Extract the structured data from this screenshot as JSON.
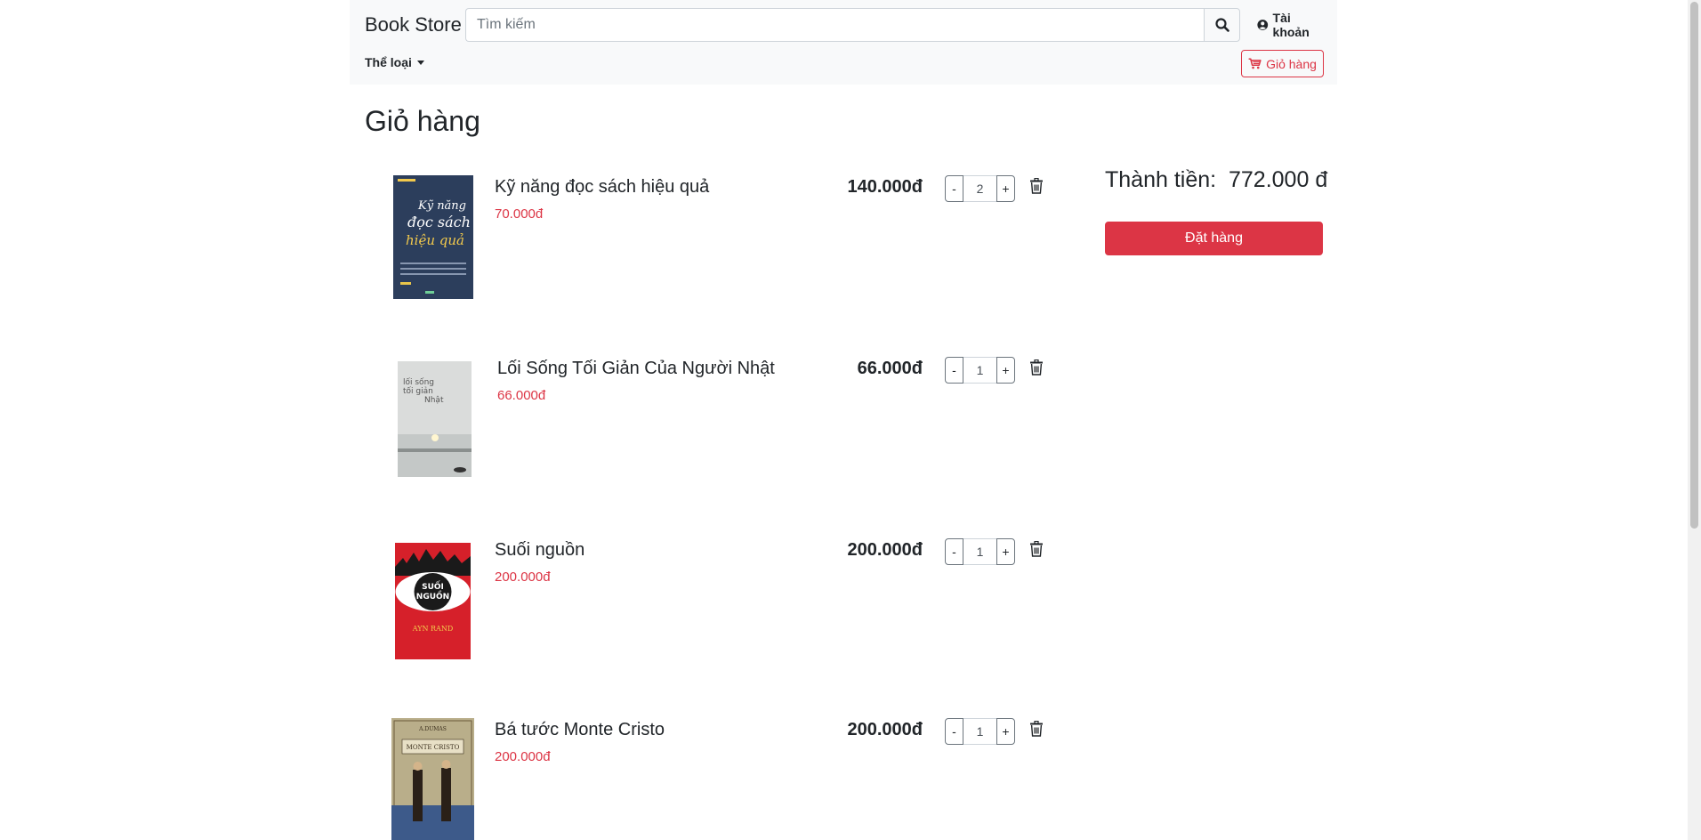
{
  "header": {
    "brand": "Book Store",
    "search_placeholder": "Tìm kiếm",
    "account_label": "Tài khoản",
    "category_label": "Thể loại",
    "cart_label": "Giỏ hàng"
  },
  "page": {
    "title": "Giỏ hàng"
  },
  "cart": {
    "items": [
      {
        "name": "Kỹ năng đọc sách hiệu quả",
        "unit_price": "70.000đ",
        "total": "140.000đ",
        "quantity": "2",
        "cover_color": "#2c3e5c"
      },
      {
        "name": "Lối Sống Tối Giản Của Người Nhật",
        "unit_price": "66.000đ",
        "total": "66.000đ",
        "quantity": "1",
        "cover_color": "#dadcdb"
      },
      {
        "name": "Suối nguồn",
        "unit_price": "200.000đ",
        "total": "200.000đ",
        "quantity": "1",
        "cover_color": "#d6202a"
      },
      {
        "name": "Bá tước Monte Cristo",
        "unit_price": "200.000đ",
        "total": "200.000đ",
        "quantity": "1",
        "cover_color": "#b9ae8a"
      }
    ],
    "minus_label": "-",
    "plus_label": "+"
  },
  "summary": {
    "label": "Thành tiền:",
    "total": "772.000 đ",
    "order_label": "Đặt hàng"
  },
  "colors": {
    "accent": "#dc3545",
    "navbar_bg": "#f8f9fa"
  }
}
